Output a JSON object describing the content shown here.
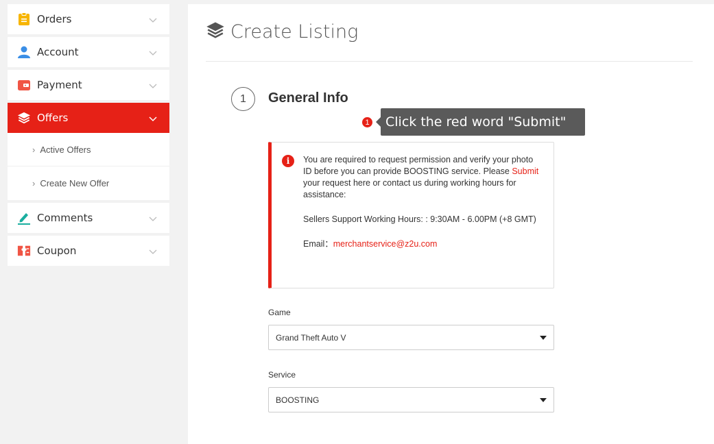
{
  "sidebar": {
    "items": [
      {
        "label": "Orders"
      },
      {
        "label": "Account"
      },
      {
        "label": "Payment"
      },
      {
        "label": "Offers"
      },
      {
        "label": "Comments"
      },
      {
        "label": "Coupon"
      }
    ],
    "offers_submenu": [
      {
        "label": "Active Offers"
      },
      {
        "label": "Create New Offer"
      }
    ]
  },
  "main": {
    "title": "Create Listing",
    "step": {
      "number": "1",
      "title": "General Info"
    },
    "tooltip": {
      "badge": "1",
      "text": "Click the red word \"Submit\""
    },
    "alert": {
      "line1": "You are required to request permission and verify your photo ID before you can provide BOOSTING service.",
      "please": "Please ",
      "submit_link": "Submit",
      "after_submit": " your request here or contact us during working hours for assistance:",
      "hours": "Sellers Support Working Hours: : 9:30AM - 6.00PM (+8 GMT)",
      "email_label": "Email：",
      "email": "merchantservice@z2u.com"
    },
    "game": {
      "label": "Game",
      "value": "Grand Theft Auto V"
    },
    "service": {
      "label": "Service",
      "value": "BOOSTING"
    }
  },
  "colors": {
    "accent": "#e62117",
    "tooltip_bg": "#5a5a5a"
  }
}
